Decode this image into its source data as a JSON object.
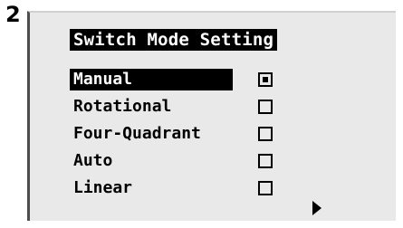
{
  "step": {
    "number": "2"
  },
  "screen": {
    "title": "Switch Mode Setting",
    "options": [
      {
        "label": "Manual",
        "selected": true,
        "checked": true
      },
      {
        "label": "Rotational",
        "selected": false,
        "checked": false
      },
      {
        "label": "Four-Quadrant",
        "selected": false,
        "checked": false
      },
      {
        "label": "Auto",
        "selected": false,
        "checked": false
      },
      {
        "label": "Linear",
        "selected": false,
        "checked": false
      }
    ],
    "icons": {
      "checkbox_checked": "checkbox-checked-icon",
      "checkbox_empty": "checkbox-empty-icon",
      "next": "right-arrow-icon"
    }
  }
}
